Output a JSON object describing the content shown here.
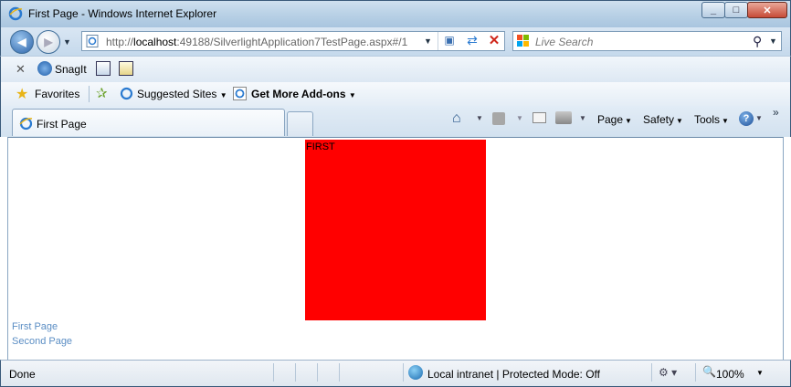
{
  "window": {
    "title": "First Page - Windows Internet Explorer"
  },
  "window_controls": {
    "minimize": "_",
    "maximize": "□",
    "close": "✕"
  },
  "address": {
    "url_prefix": "http://",
    "url_host": "localhost",
    "url_rest": ":49188/SilverlightApplication7TestPage.aspx#/1"
  },
  "search": {
    "placeholder": "Live Search"
  },
  "toolbar": {
    "snagit_label": "SnagIt"
  },
  "favorites": {
    "favorites_label": "Favorites",
    "suggested_sites": "Suggested Sites",
    "get_more_addons": "Get More Add-ons"
  },
  "tab": {
    "label": "First Page"
  },
  "commands": {
    "page": "Page",
    "safety": "Safety",
    "tools": "Tools",
    "help": "?"
  },
  "content": {
    "box_text": "FIRST",
    "box_color": "#ff0000",
    "links": [
      "First Page",
      "Second Page"
    ]
  },
  "status": {
    "text": "Done",
    "zone": "Local intranet | Protected Mode: Off",
    "zoom": "100%"
  }
}
